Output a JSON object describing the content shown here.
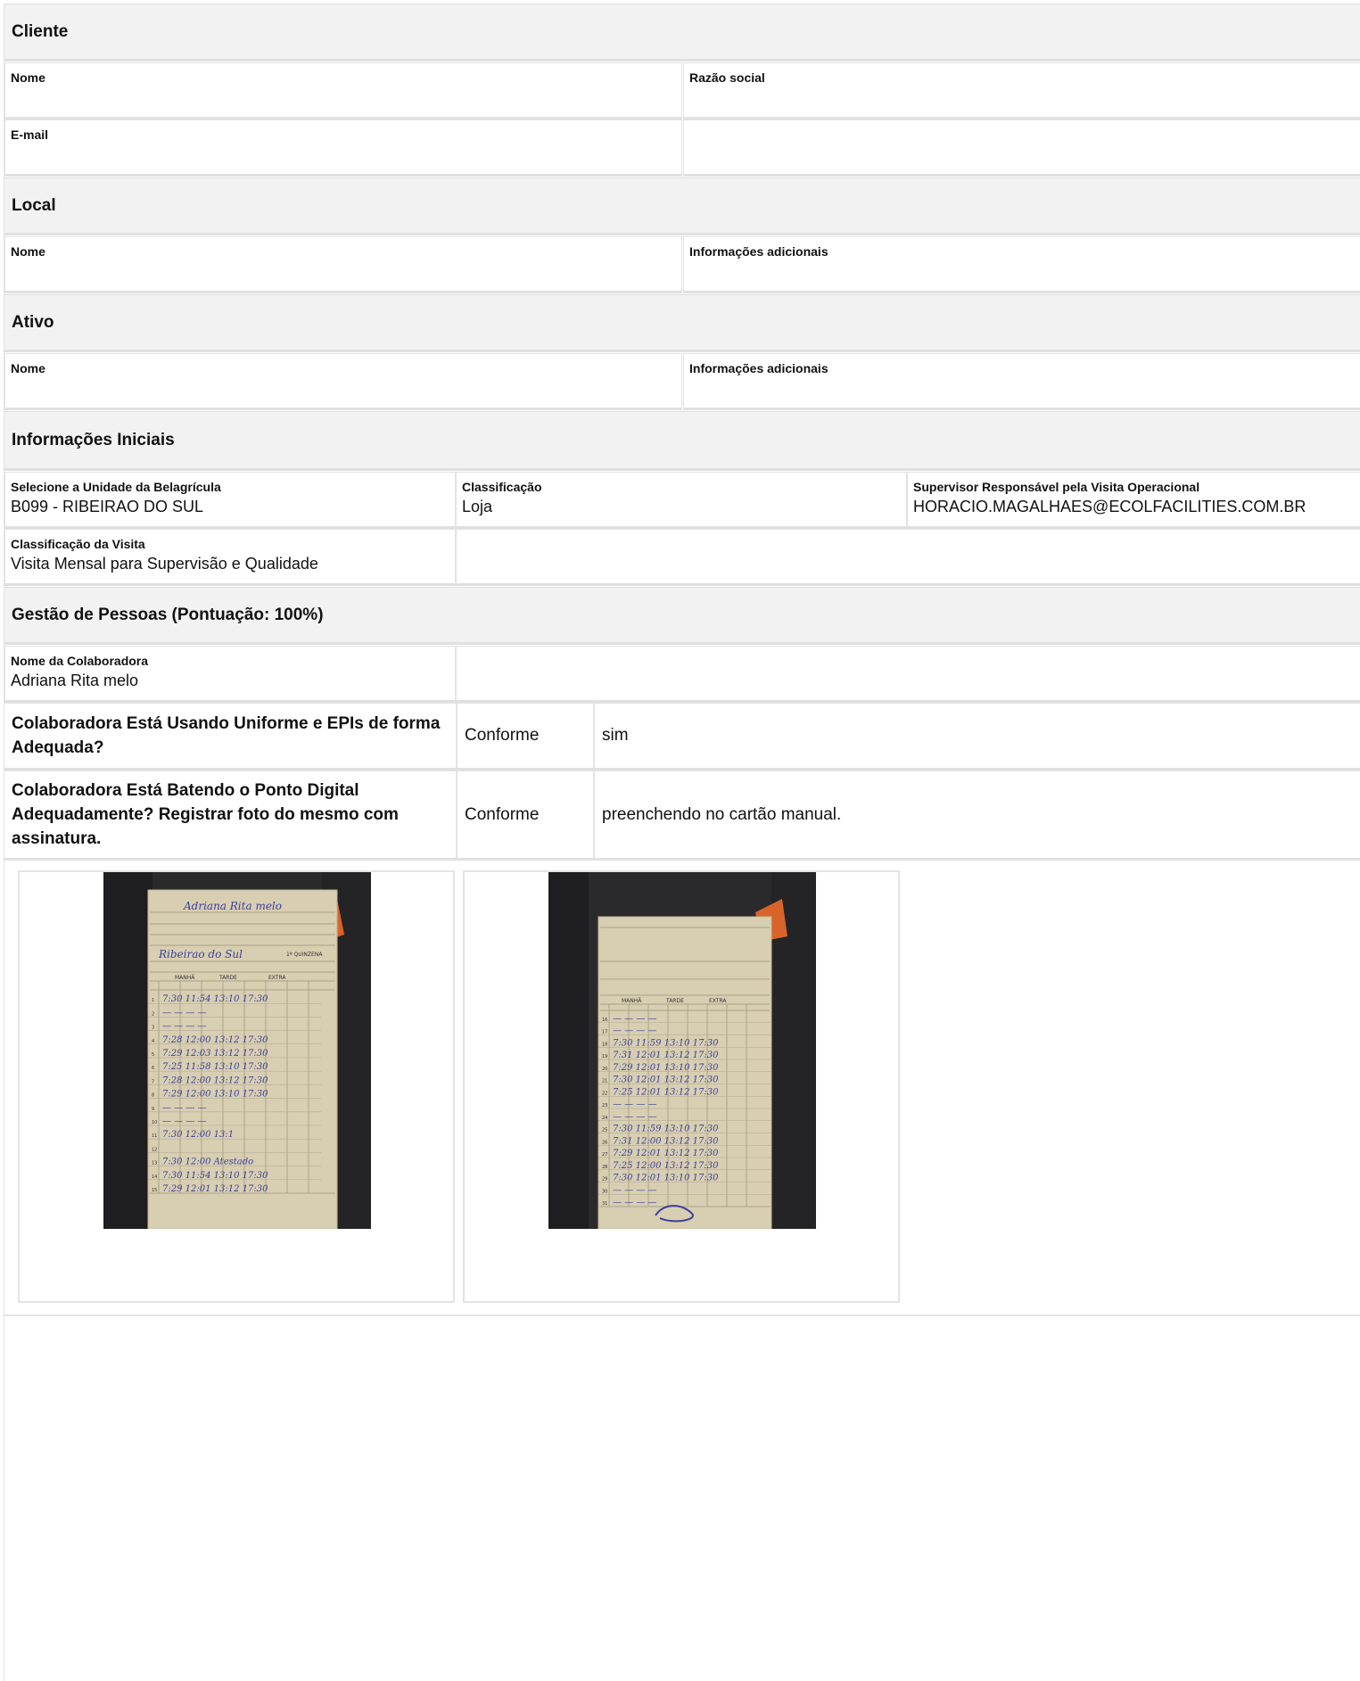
{
  "sections": {
    "cliente": {
      "title": "Cliente",
      "nome_label": "Nome",
      "razao_label": "Razão social",
      "email_label": "E-mail"
    },
    "local": {
      "title": "Local",
      "nome_label": "Nome",
      "info_label": "Informações adicionais"
    },
    "ativo": {
      "title": "Ativo",
      "nome_label": "Nome",
      "info_label": "Informações adicionais"
    },
    "iniciais": {
      "title": "Informações Iniciais",
      "unidade_label": "Selecione a Unidade da Belagrícula",
      "unidade_value": "B099 - RIBEIRAO DO SUL",
      "classificacao_label": "Classificação",
      "classificacao_value": "Loja",
      "supervisor_label": "Supervisor Responsável pela Visita Operacional",
      "supervisor_value": "HORACIO.MAGALHAES@ECOLFACILITIES.COM.BR",
      "visita_label": "Classificação da Visita",
      "visita_value": "Visita Mensal para Supervisão e Qualidade"
    },
    "gestao": {
      "title": "Gestão de Pessoas (Pontuação: 100%)",
      "colab_label": "Nome da Colaboradora",
      "colab_value": "Adriana Rita melo"
    }
  },
  "questions": [
    {
      "title": "Colaboradora Está Usando Uniforme e EPIs de forma Adequada?",
      "status": "Conforme",
      "comment": "sim"
    },
    {
      "title": "Colaboradora Está Batendo o Ponto Digital Adequadamente? Registrar foto do mesmo com assinatura.",
      "status": "Conforme",
      "comment": "preenchendo no cartão manual."
    }
  ],
  "photos": {
    "card1": {
      "name_line": "Adriana Rita melo",
      "place_line": "Ribeirao do Sul",
      "quinzena": "1ª QUINZENA",
      "col_manha": "MANHÃ",
      "col_tarde": "TARDE",
      "col_extra": "EXTRA",
      "rows": [
        {
          "d": "1",
          "t": "7:30 11:54 13:10 17:30"
        },
        {
          "d": "2",
          "t": "—  —  —  —"
        },
        {
          "d": "3",
          "t": "—  —  —  —"
        },
        {
          "d": "4",
          "t": "7:28 12:00 13:12 17:30"
        },
        {
          "d": "5",
          "t": "7:29 12:03 13:12 17:30"
        },
        {
          "d": "6",
          "t": "7:25 11:58 13:10 17:30"
        },
        {
          "d": "7",
          "t": "7:28 12:00 13:12 17:30"
        },
        {
          "d": "8",
          "t": "7:29 12:00 13:10 17:30"
        },
        {
          "d": "9",
          "t": "—  —  —  —"
        },
        {
          "d": "10",
          "t": "—  —  —  —"
        },
        {
          "d": "11",
          "t": "7:30 12:00 13:1"
        },
        {
          "d": "12",
          "t": ""
        },
        {
          "d": "13",
          "t": "7:30 12:00 Atestado"
        },
        {
          "d": "14",
          "t": "7:30 11:54 13:10 17:30"
        },
        {
          "d": "15",
          "t": "7:29 12:01 13:12 17:30"
        }
      ]
    },
    "card2": {
      "col_manha": "MANHÃ",
      "col_tarde": "TARDE",
      "col_extra": "EXTRA",
      "rows": [
        {
          "d": "16",
          "t": "—  —  —  —"
        },
        {
          "d": "17",
          "t": "—  —  —  —"
        },
        {
          "d": "18",
          "t": "7:30 11:59 13:10 17:30"
        },
        {
          "d": "19",
          "t": "7:31 12:01 13:12 17:30"
        },
        {
          "d": "20",
          "t": "7:29 12:01 13:10 17:30"
        },
        {
          "d": "21",
          "t": "7:30 12:01 13:12 17:30"
        },
        {
          "d": "22",
          "t": "7:25 12:01 13:12 17:30"
        },
        {
          "d": "23",
          "t": "—  —  —  —"
        },
        {
          "d": "24",
          "t": "—  —  —  —"
        },
        {
          "d": "25",
          "t": "7:30 11:59 13:10 17:30"
        },
        {
          "d": "26",
          "t": "7:31 12:00 13:12 17:30"
        },
        {
          "d": "27",
          "t": "7:29 12:01 13:12 17:30"
        },
        {
          "d": "28",
          "t": "7:25 12:00 13:12 17:30"
        },
        {
          "d": "29",
          "t": "7:30 12:01 13:10 17:30"
        },
        {
          "d": "30",
          "t": "—  —  —  —"
        },
        {
          "d": "31",
          "t": "—  —  —  —"
        }
      ]
    }
  }
}
